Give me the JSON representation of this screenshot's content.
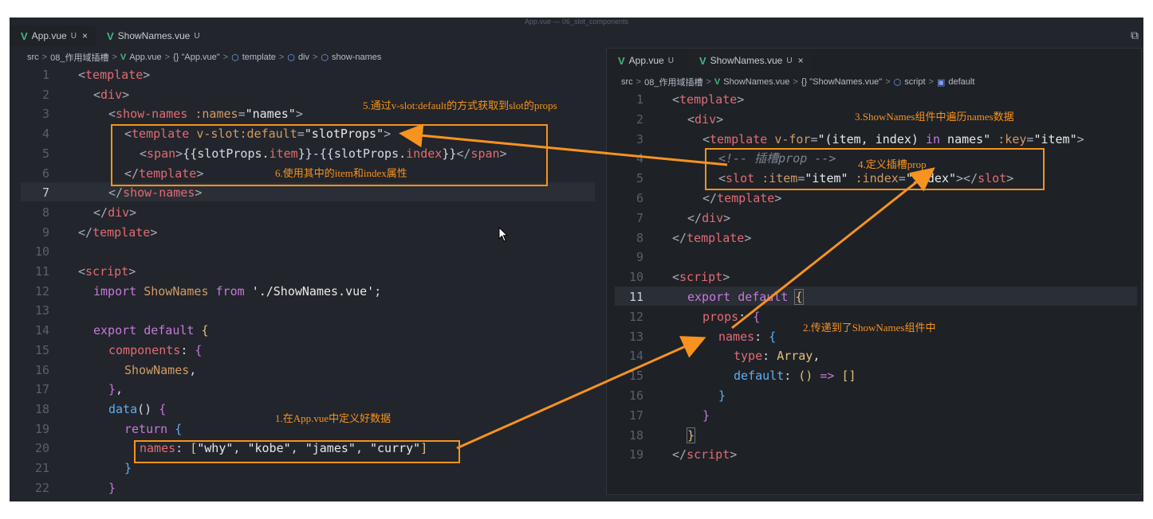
{
  "window": {
    "title": "App.vue — 06_slot_components"
  },
  "left": {
    "tabs": [
      {
        "name": "App.vue",
        "modified": "U",
        "close": "×"
      },
      {
        "name": "ShowNames.vue",
        "modified": "U"
      }
    ],
    "breadcrumb": [
      "src",
      "08_作用域插槽",
      "App.vue",
      "{} \"App.vue\"",
      "template",
      "div",
      "show-names"
    ],
    "line_numbers": [
      "1",
      "2",
      "3",
      "4",
      "5",
      "6",
      "7",
      "8",
      "9",
      "10",
      "11",
      "12",
      "13",
      "14",
      "15",
      "16",
      "17",
      "18",
      "19",
      "20",
      "21",
      "22"
    ]
  },
  "right": {
    "tabs": [
      {
        "name": "App.vue",
        "modified": "U"
      },
      {
        "name": "ShowNames.vue",
        "modified": "U",
        "close": "×"
      }
    ],
    "breadcrumb": [
      "src",
      "08_作用域插槽",
      "ShowNames.vue",
      "{} \"ShowNames.vue\"",
      "script",
      "default"
    ],
    "line_numbers": [
      "1",
      "2",
      "3",
      "4",
      "5",
      "6",
      "7",
      "8",
      "9",
      "10",
      "11",
      "12",
      "13",
      "14",
      "15",
      "16",
      "17",
      "18",
      "19"
    ]
  },
  "annotations": {
    "a1": "1.在App.vue中定义好数据",
    "a2": "2.传递到了ShowNames组件中",
    "a3": "3.ShowNames组件中遍历names数据",
    "a4": "4.定义插槽prop",
    "a5": "5.通过v-slot:default的方式获取到slot的props",
    "a6": "6.使用其中的item和index属性"
  },
  "colors": {
    "accent": "#f7931e",
    "vue": "#42b883",
    "bg": "#22252b"
  }
}
